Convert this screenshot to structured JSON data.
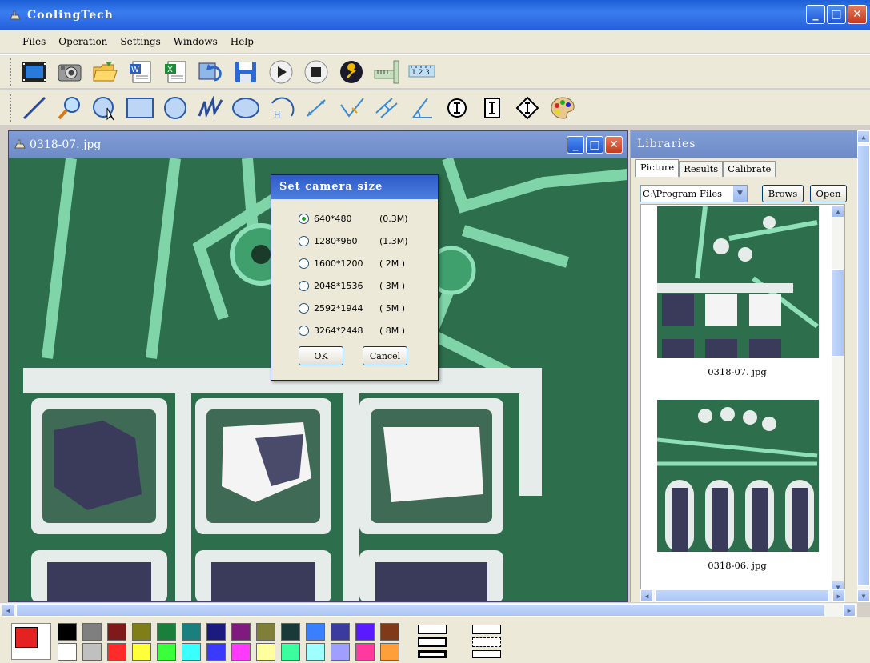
{
  "app": {
    "title": "CoolingTech"
  },
  "menu": [
    "Files",
    "Operation",
    "Settings",
    "Windows",
    "Help"
  ],
  "toolbar1": [
    "video-capture-icon",
    "camera-icon",
    "open-folder-icon",
    "word-export-icon",
    "excel-export-icon",
    "refresh-icon",
    "save-icon",
    "play-icon",
    "stop-icon",
    "wrench-icon",
    "ruler-icon",
    "scale-ruler-icon"
  ],
  "toolbar2": [
    "line-tool-icon",
    "magnifier-icon",
    "ellipse-select-icon",
    "rectangle-tool-icon",
    "circle-tool-icon",
    "freehand-tool-icon",
    "ellipse-tool-icon",
    "arc-tool-icon",
    "distance-tool-icon",
    "angle-tool-icon",
    "parallel-tool-icon",
    "angle-measure-icon",
    "text-circle-icon",
    "text-box-icon",
    "diamond-text-icon",
    "palette-icon"
  ],
  "image_window": {
    "title": "0318-07. jpg"
  },
  "dialog": {
    "title": "Set camera size",
    "options": [
      {
        "res": "640*480",
        "size": "(0.3M)",
        "selected": true
      },
      {
        "res": "1280*960",
        "size": "(1.3M)",
        "selected": false
      },
      {
        "res": "1600*1200",
        "size": "( 2M )",
        "selected": false
      },
      {
        "res": "2048*1536",
        "size": "( 3M )",
        "selected": false
      },
      {
        "res": "2592*1944",
        "size": "( 5M )",
        "selected": false
      },
      {
        "res": "3264*2448",
        "size": "( 8M )",
        "selected": false
      }
    ],
    "ok": "OK",
    "cancel": "Cancel"
  },
  "libraries": {
    "title": "Libraries",
    "tabs": [
      "Picture",
      "Results",
      "Calibrate"
    ],
    "path": "C:\\Program Files",
    "browse": "Brows",
    "open": "Open",
    "thumbs": [
      "0318-07. jpg",
      "0318-06. jpg"
    ]
  },
  "palette": {
    "current_color": "#e52222",
    "top_row": [
      "#000000",
      "#7f7f7f",
      "#7f1a1a",
      "#7f7f1a",
      "#1a7f3a",
      "#1a7f7f",
      "#1a1a7f",
      "#7f1a7f",
      "#7f7f3a",
      "#1a3a3a",
      "#3a7fff",
      "#3a3a9f",
      "#5a1aff",
      "#7f3a1a"
    ],
    "bottom_row": [
      "#ffffff",
      "#c0c0c0",
      "#ff2a2a",
      "#ffff3a",
      "#3aff3a",
      "#3affff",
      "#3a3aff",
      "#ff3aff",
      "#ffff9f",
      "#3aff9f",
      "#9fffff",
      "#9f9fff",
      "#ff3a9f",
      "#ff9f3a"
    ]
  }
}
